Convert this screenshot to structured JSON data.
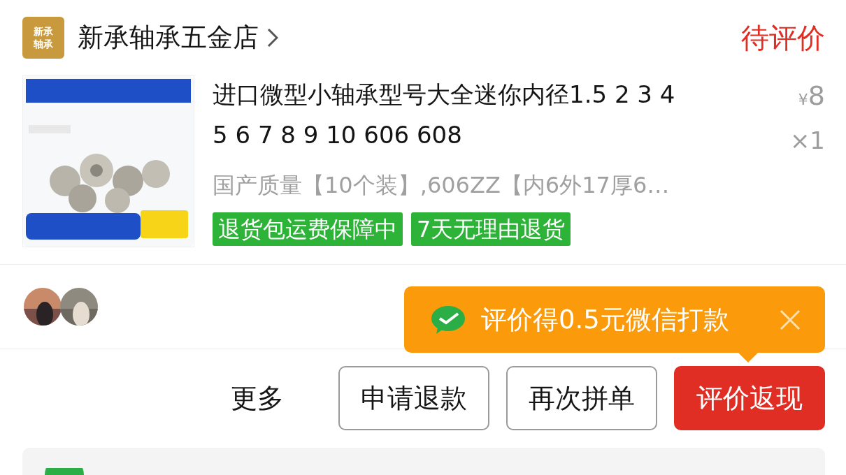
{
  "shop": {
    "logo_lines": [
      "新承",
      "轴承"
    ],
    "name": "新承轴承五金店",
    "status": "待评价"
  },
  "product": {
    "title": "进口微型小轴承型号大全迷你内径1.5 2 3 4\n5 6 7 8 9 10 606 608",
    "currency": "¥",
    "price": "8",
    "quantity": "×1",
    "spec": "国产质量【10个装】,606ZZ【内6外17厚6…",
    "tags": [
      "退货包运费保障中",
      "7天无理由退货"
    ]
  },
  "tooltip": {
    "text": "评价得0.5元微信打款"
  },
  "buttons": [
    {
      "label": "更多",
      "kind": "text"
    },
    {
      "label": "申请退款",
      "kind": "outline"
    },
    {
      "label": "再次拼单",
      "kind": "outline"
    },
    {
      "label": "评价返现",
      "kind": "primary"
    }
  ]
}
